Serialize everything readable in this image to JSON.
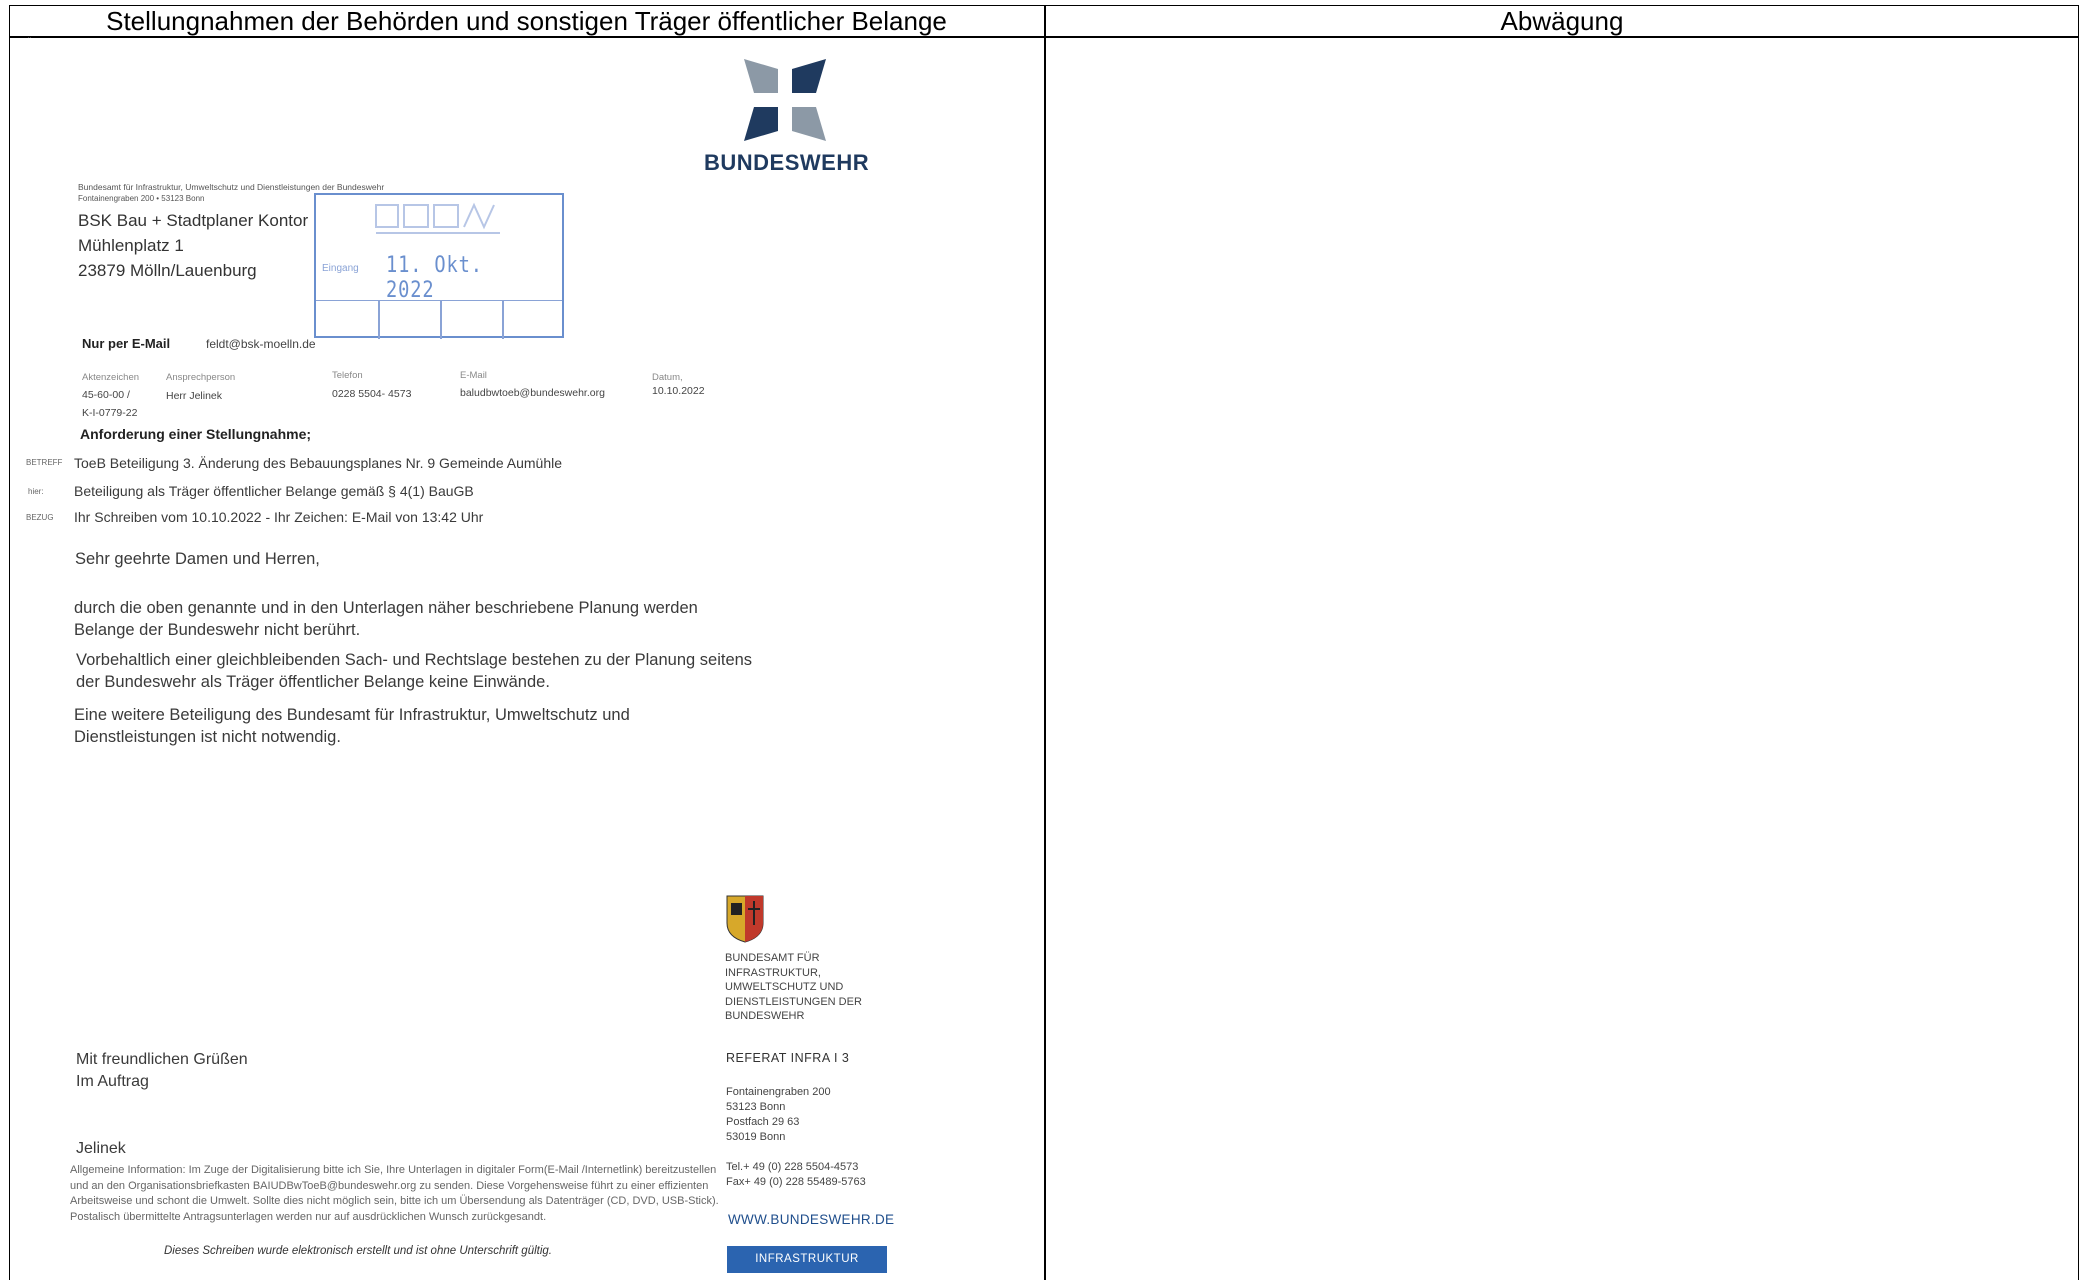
{
  "table": {
    "left_header": "Stellungnahmen der Behörden und sonstigen Träger öffentlicher Belange",
    "right_header": "Abwägung",
    "tiny_mark": "¨"
  },
  "letter": {
    "logo_text": "BUNDESWEHR",
    "sender_line": "Bundesamt für Infrastruktur, Umweltschutz und Dienstleistungen der Bundeswehr",
    "sender_line2": "Fontainengraben 200 • 53123 Bonn",
    "recipient": [
      "BSK Bau + Stadtplaner Kontor",
      "Mühlenplatz 1",
      "23879 Mölln/Lauenburg"
    ],
    "stamp": {
      "label": "Eingang",
      "date": "11. Okt. 2022"
    },
    "delivery": {
      "label": "Nur per E-Mail",
      "value": "feldt@bsk-moelln.de"
    },
    "reference": {
      "aktenzeichen_label": "Aktenzeichen",
      "aktenzeichen_value": [
        "45-60-00 /",
        "K-I-0779-22"
      ],
      "ansprechperson_label": "Ansprechperson",
      "ansprechperson_value": "Herr Jelinek",
      "telefon_label": "Telefon",
      "telefon_value": "0228 5504- 4573",
      "email_label": "E-Mail",
      "email_value": "baludbwtoeb@bundeswehr.org",
      "datum_label": "Datum,",
      "datum_value": "10.10.2022"
    },
    "request_title": "Anforderung einer Stellungnahme;",
    "meta": {
      "betreff_key": "BETREFF",
      "betreff": "ToeB Beteiligung 3. Änderung des Bebauungsplanes Nr. 9 Gemeinde Aumühle",
      "hier_key": "hier:",
      "hier": "Beteiligung als Träger öffentlicher Belange gemäß § 4(1) BauGB",
      "bezug_key": "BEZUG",
      "bezug": "Ihr Schreiben vom 10.10.2022  - Ihr Zeichen:  E-Mail von 13:42 Uhr"
    },
    "salutation": "Sehr geehrte Damen und Herren,",
    "paragraphs": [
      "durch die oben genannte und in den Unterlagen näher beschriebene Planung werden Belange der Bundeswehr nicht berührt.",
      "Vorbehaltlich einer gleichbleibenden Sach- und Rechtslage bestehen zu der Planung seitens der Bundeswehr als Träger öffentlicher Belange keine Einwände.",
      "Eine weitere Beteiligung des Bundesamt für Infrastruktur, Umweltschutz und Dienstleistungen ist nicht notwendig."
    ],
    "agency_name": "BUNDESAMT FÜR INFRASTRUKTUR, UMWELTSCHUTZ UND DIENSTLEISTUNGEN DER BUNDESWEHR",
    "referat": "REFERAT INFRA I 3",
    "address": [
      "Fontainengraben 200",
      "53123 Bonn",
      "Postfach 29 63",
      "53019 Bonn"
    ],
    "tel": "Tel.+ 49 (0) 228 5504-4573",
    "fax": "Fax+ 49 (0) 228 55489-5763",
    "website": "WWW.BUNDESWEHR.DE",
    "infra_button": "INFRASTRUKTUR",
    "closing": [
      "Mit freundlichen Grüßen",
      "Im Auftrag"
    ],
    "signer": "Jelinek",
    "info": "Allgemeine Information: Im Zuge der Digitalisierung bitte ich Sie, Ihre Unterlagen in digitaler Form(E-Mail /Internetlink) bereitzustellen und an den Organisationsbriefkasten BAIUDBwToeB@bundeswehr.org zu senden. Diese Vorgehensweise führt zu einer effizienten Arbeitsweise und schont die Umwelt. Sollte dies nicht möglich sein, bitte ich um Übersendung als Datenträger (CD, DVD, USB-Stick). Postalisch übermittelte Antragsunterlagen werden nur auf ausdrücklichen Wunsch zurückgesandt.",
    "footer_note": "Dieses Schreiben wurde elektronisch erstellt und ist ohne Unterschrift gültig."
  },
  "colors": {
    "stamp": "#6a8fce",
    "brand_blue": "#2b64b0",
    "logo_gray": "#8c99a6",
    "logo_navy": "#1f3a5f"
  },
  "icons": [
    "bundeswehr-cross-icon",
    "federal-crest-icon",
    "stamp-logo-icon"
  ]
}
